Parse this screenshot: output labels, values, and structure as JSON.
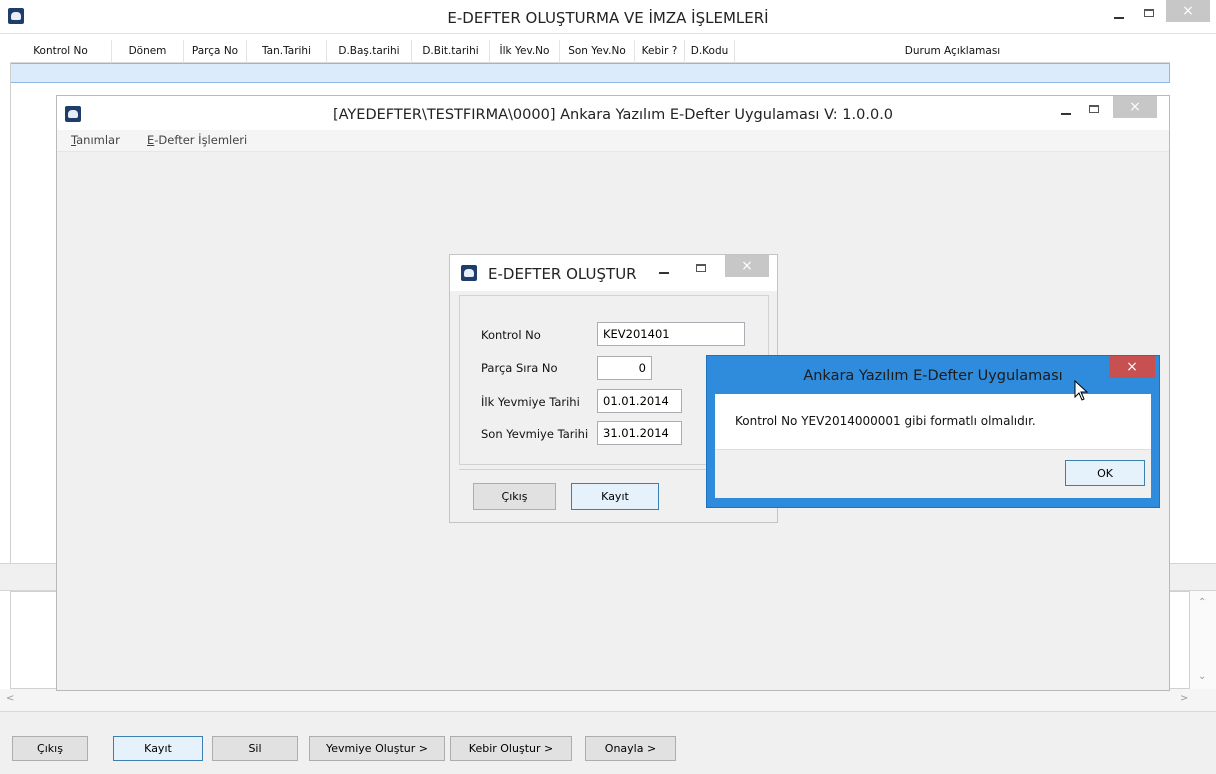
{
  "main_window": {
    "title": "E-DEFTER OLUŞTURMA VE İMZA İŞLEMLERİ",
    "close_glyph": "×",
    "columns": [
      "Kontrol No",
      "Dönem",
      "Parça No",
      "Tan.Tarihi",
      "D.Baş.tarihi",
      "D.Bit.tarihi",
      "İlk Yev.No",
      "Son Yev.No",
      "Kebir ?",
      "D.Kodu",
      "Durum Açıklaması"
    ],
    "buttons": {
      "exit": "Çıkış",
      "save": "Kayıt",
      "delete": "Sil",
      "create_journal": "Yevmiye Oluştur >",
      "create_ledger": "Kebir Oluştur >",
      "approve": "Onayla >"
    }
  },
  "inner_window": {
    "title": "[AYEDEFTER\\TESTFIRMA\\0000] Ankara Yazılım E-Defter Uygulaması V: 1.0.0.0",
    "close_glyph": "×",
    "menu": {
      "definitions": "Tanımlar",
      "edefter_ops": "E-Defter İşlemleri"
    }
  },
  "create_dialog": {
    "title": "E-DEFTER OLUŞTUR",
    "close_glyph": "×",
    "fields": {
      "control_no_label": "Kontrol No",
      "control_no_value": "KEV201401",
      "part_no_label": "Parça Sıra No",
      "part_no_value": "0",
      "first_date_label": "İlk Yevmiye Tarihi",
      "first_date_value": "01.01.2014",
      "last_date_label": "Son Yevmiye Tarihi",
      "last_date_value": "31.01.2014"
    },
    "buttons": {
      "exit": "Çıkış",
      "save": "Kayıt"
    }
  },
  "message_box": {
    "title": "Ankara Yazılım E-Defter Uygulaması",
    "close_glyph": "×",
    "text": "Kontrol No YEV2014000001 gibi formatlı olmalıdır.",
    "ok": "OK"
  },
  "colors": {
    "message_frame": "#2f8bdc",
    "close_red": "#c75050",
    "selected_row": "#dcebfc",
    "default_button_border": "#3c7fb1"
  }
}
